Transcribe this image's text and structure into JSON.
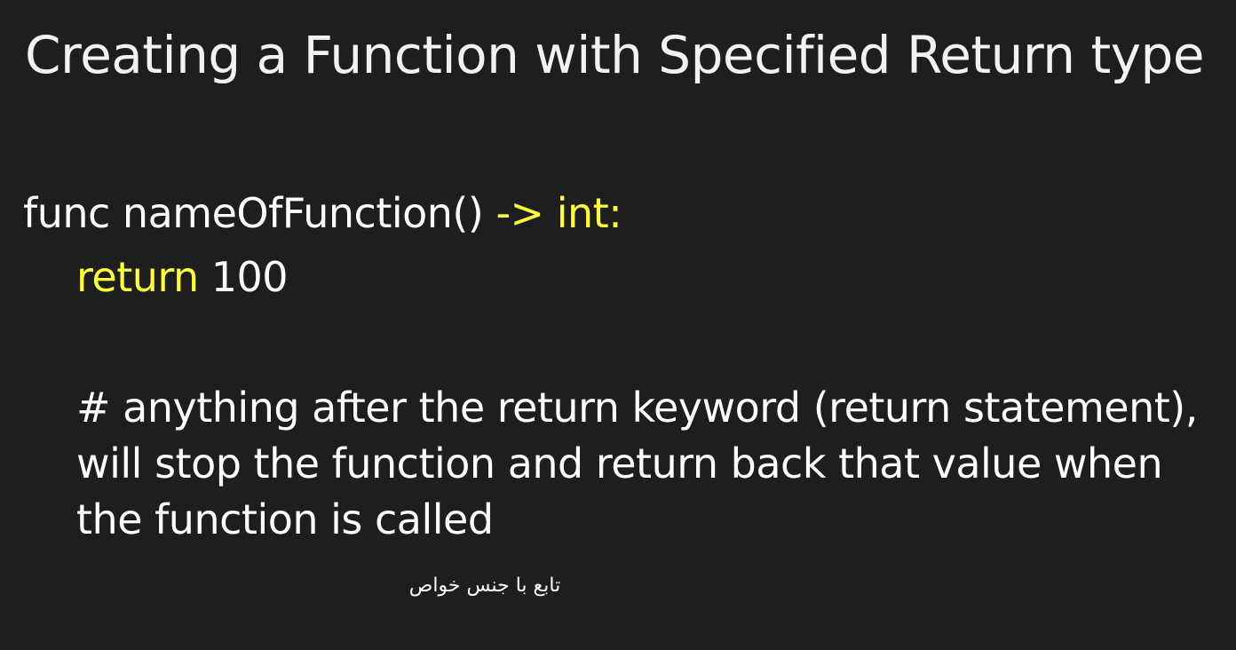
{
  "slide": {
    "title": "Creating a Function with Specified Return type",
    "code": {
      "line1": {
        "text": "func nameOfFunction() ",
        "keyword": "-> int:"
      },
      "line2": {
        "keyword": "return",
        "text": " 100"
      }
    },
    "comment": "# anything after the return keyword (return statement), will stop the function and return back that value when the function is called"
  },
  "caption": "تابع با جنس خواص",
  "colors": {
    "background": "#1e1e1e",
    "text": "#ffffff",
    "keyword": "#ffff33"
  }
}
